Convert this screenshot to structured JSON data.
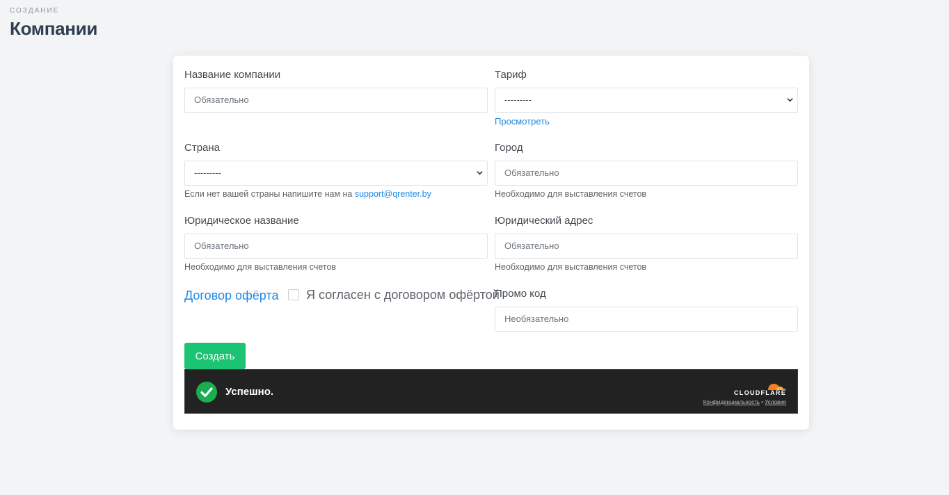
{
  "header": {
    "overline": "СОЗДАНИЕ",
    "title": "Компании"
  },
  "form": {
    "company_name": {
      "label": "Название компании",
      "placeholder": "Обязательно"
    },
    "tariff": {
      "label": "Тариф",
      "selected": "---------",
      "view_link": "Просмотреть"
    },
    "country": {
      "label": "Страна",
      "selected": "---------",
      "hint_text": "Если нет вашей страны напишите нам на ",
      "hint_email": "support@qrenter.by"
    },
    "city": {
      "label": "Город",
      "placeholder": "Обязательно",
      "hint": "Необходимо для выставления счетов"
    },
    "legal_name": {
      "label": "Юридическое название",
      "placeholder": "Обязательно",
      "hint": "Необходимо для выставления счетов"
    },
    "legal_address": {
      "label": "Юридический адрес",
      "placeholder": "Обязательно",
      "hint": "Необходимо для выставления счетов"
    },
    "offer_link": "Договор офёрта",
    "agree_label": "Я согласен с договором офёртой",
    "promo": {
      "label": "Промо код",
      "placeholder": "Необязательно"
    },
    "submit_label": "Создать"
  },
  "captcha": {
    "status": "Успешно.",
    "brand": "CLOUDFLARE",
    "privacy": "Конфиденциальность",
    "separator": "•",
    "terms": "Условия"
  },
  "colors": {
    "accent": "#1e88e5",
    "success": "#1bc472",
    "cloudflare": "#f38020"
  }
}
